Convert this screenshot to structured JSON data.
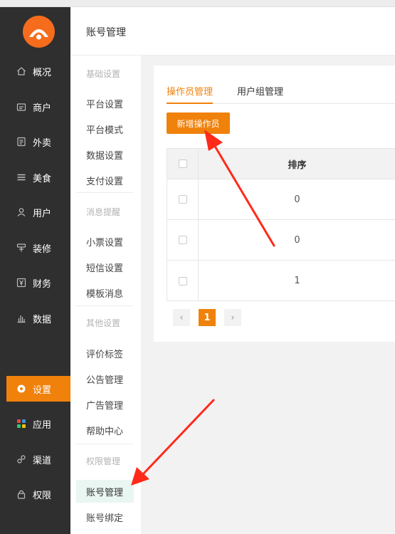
{
  "header": {
    "title": "账号管理"
  },
  "sidebar": {
    "items": [
      {
        "label": "概况",
        "icon": "home-icon"
      },
      {
        "label": "商户",
        "icon": "merchant-icon"
      },
      {
        "label": "外卖",
        "icon": "document-icon"
      },
      {
        "label": "美食",
        "icon": "menu-icon"
      },
      {
        "label": "用户",
        "icon": "user-icon"
      },
      {
        "label": "装修",
        "icon": "brush-icon"
      },
      {
        "label": "财务",
        "icon": "yen-icon"
      },
      {
        "label": "数据",
        "icon": "bar-chart-icon"
      },
      {
        "label": "设置",
        "icon": "gear-icon",
        "active": true
      },
      {
        "label": "应用",
        "icon": "apps-icon"
      },
      {
        "label": "渠道",
        "icon": "link-icon"
      },
      {
        "label": "权限",
        "icon": "lock-icon"
      }
    ]
  },
  "subnav": {
    "groups": [
      {
        "title": "基础设置",
        "items": [
          "平台设置",
          "平台模式",
          "数据设置",
          "支付设置"
        ]
      },
      {
        "title": "消息提醒",
        "items": [
          "小票设置",
          "短信设置",
          "模板消息"
        ]
      },
      {
        "title": "其他设置",
        "items": [
          "评价标签",
          "公告管理",
          "广告管理",
          "帮助中心"
        ]
      },
      {
        "title": "权限管理",
        "items": [
          "账号管理",
          "账号绑定"
        ]
      }
    ],
    "active": "账号管理"
  },
  "main": {
    "tabs": [
      {
        "label": "操作员管理",
        "active": true
      },
      {
        "label": "用户组管理",
        "active": false
      }
    ],
    "add_button": "新增操作员",
    "table": {
      "columns": [
        "排序"
      ],
      "rows": [
        "0",
        "0",
        "1"
      ]
    },
    "pagination": {
      "prev": "‹",
      "current": "1",
      "next": "›"
    }
  },
  "colors": {
    "accent": "#f0810b",
    "sidebar_bg": "#2f2f2f",
    "annotation": "#ff2a1a"
  }
}
